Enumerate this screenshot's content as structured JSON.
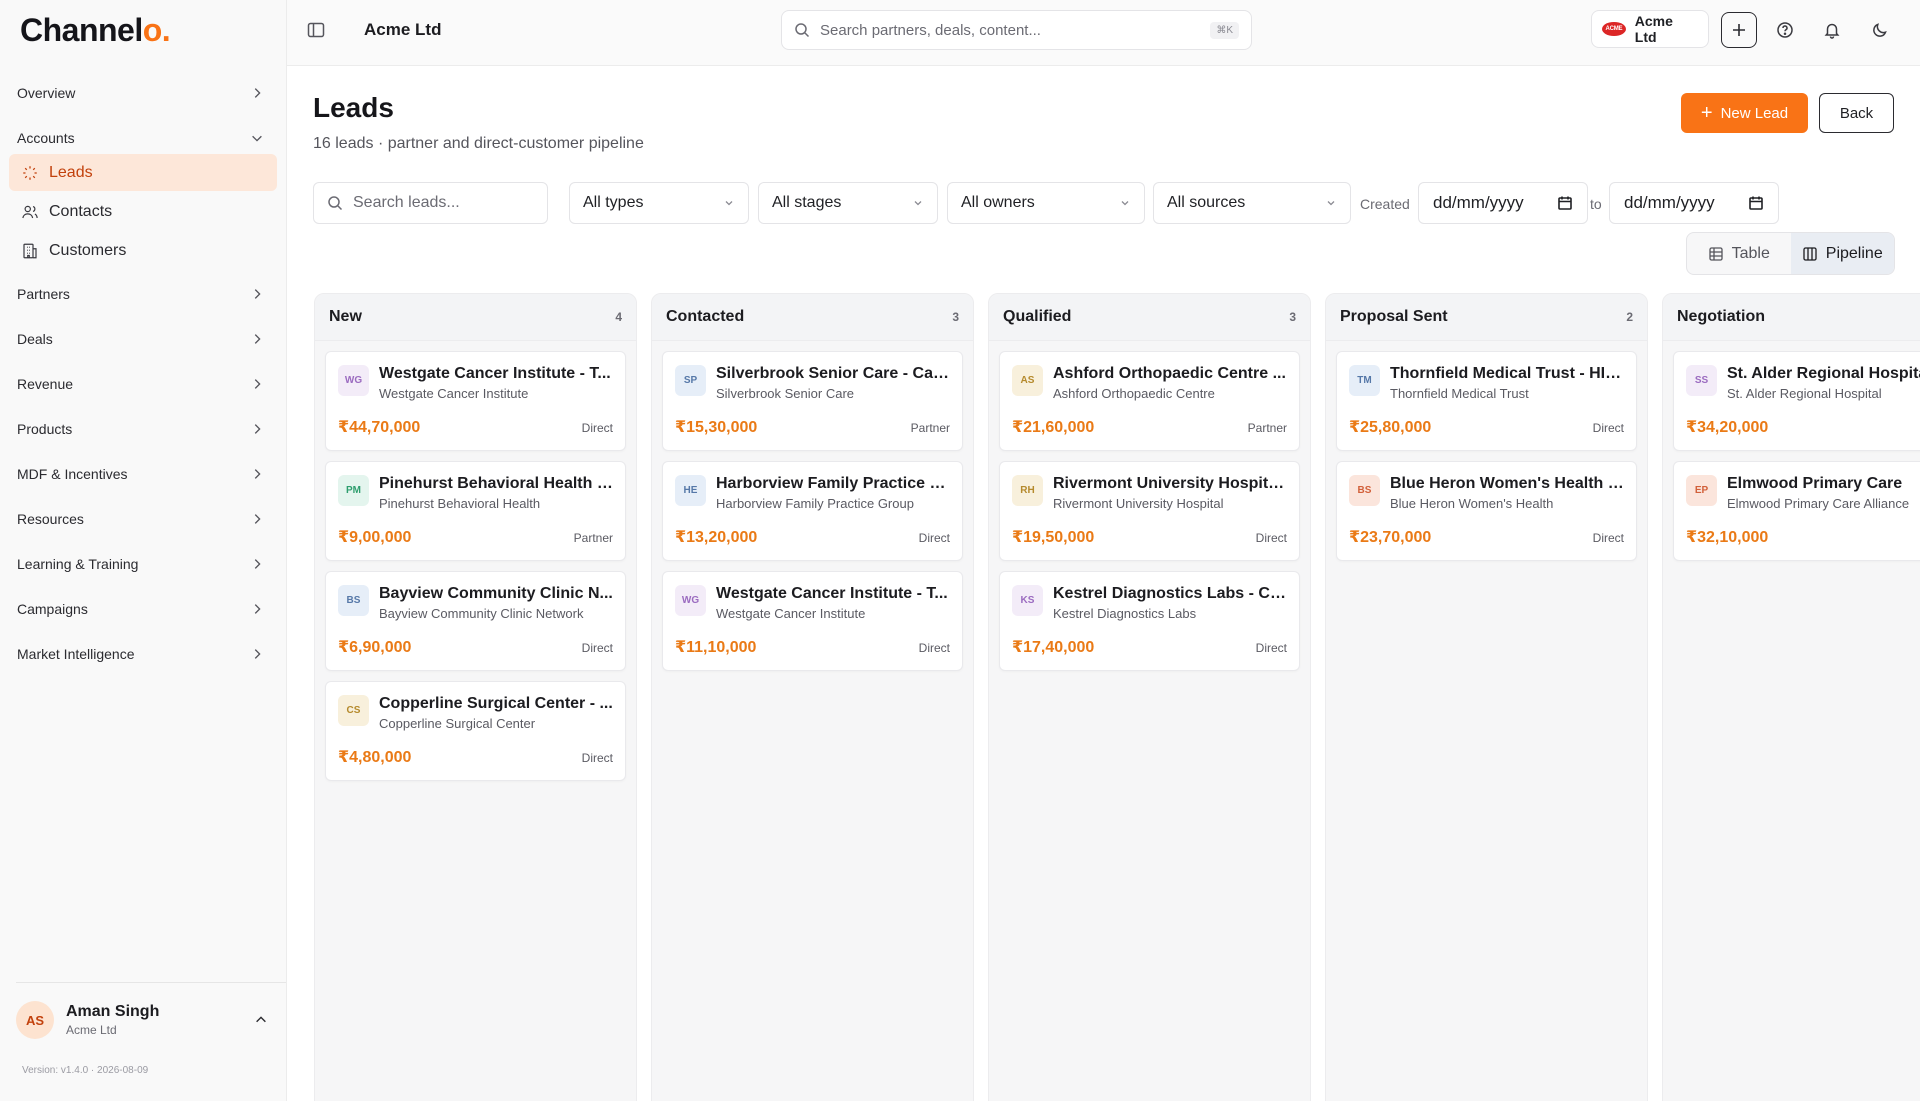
{
  "app": {
    "logo_main": "Channel",
    "logo_accent": "o."
  },
  "sidebar": {
    "top_items": [
      {
        "label": "Overview"
      },
      {
        "label": "Accounts"
      }
    ],
    "sub_items": [
      {
        "label": "Leads",
        "icon": "leads-icon",
        "active": true
      },
      {
        "label": "Contacts",
        "icon": "contacts-icon"
      },
      {
        "label": "Customers",
        "icon": "customers-icon"
      }
    ],
    "items": [
      {
        "label": "Partners"
      },
      {
        "label": "Deals"
      },
      {
        "label": "Revenue"
      },
      {
        "label": "Products"
      },
      {
        "label": "MDF & Incentives"
      },
      {
        "label": "Resources"
      },
      {
        "label": "Learning & Training"
      },
      {
        "label": "Campaigns"
      },
      {
        "label": "Market Intelligence"
      }
    ],
    "user": {
      "initials": "AS",
      "name": "Aman Singh",
      "org": "Acme Ltd"
    },
    "version": "Version: v1.4.0 · 2026-08-09"
  },
  "topbar": {
    "org_title": "Acme Ltd",
    "search_placeholder": "Search partners, deals, content...",
    "search_shortcut": "⌘K",
    "org_switch_label": "Acme Ltd",
    "org_logo_text": "ACME"
  },
  "page": {
    "title": "Leads",
    "subtitle": "16 leads · partner and direct-customer pipeline",
    "new_button": "New Lead",
    "back_button": "Back"
  },
  "filters": {
    "search_placeholder": "Search leads...",
    "type": "All types",
    "stage": "All stages",
    "owner": "All owners",
    "source": "All sources",
    "created_label": "Created",
    "to_label": "to",
    "date_from": "dd/mm/yyyy",
    "date_to": "dd/mm/yyyy"
  },
  "view_toggle": {
    "table": "Table",
    "pipeline": "Pipeline",
    "active": "pipeline"
  },
  "colors": {
    "accent": "#f97316",
    "amount": "#ea7a16"
  },
  "columns": [
    {
      "title": "New",
      "count": "4",
      "cards": [
        {
          "initials": "WG",
          "title": "Westgate Cancer Institute - T...",
          "org": "Westgate Cancer Institute",
          "amount": "₹44,70,000",
          "type": "Direct",
          "badge_bg": "#f3ecf8",
          "badge_fg": "#9b6bc0"
        },
        {
          "initials": "PM",
          "title": "Pinehurst Behavioral Health -...",
          "org": "Pinehurst Behavioral Health",
          "amount": "₹9,00,000",
          "type": "Partner",
          "badge_bg": "#e4f5ee",
          "badge_fg": "#2e9e6e"
        },
        {
          "initials": "BS",
          "title": "Bayview Community Clinic N...",
          "org": "Bayview Community Clinic Network",
          "amount": "₹6,90,000",
          "type": "Direct",
          "badge_bg": "#e6eef8",
          "badge_fg": "#5678a8"
        },
        {
          "initials": "CS",
          "title": "Copperline Surgical Center - ...",
          "org": "Copperline Surgical Center",
          "amount": "₹4,80,000",
          "type": "Direct",
          "badge_bg": "#f8f0dc",
          "badge_fg": "#b58a2c"
        }
      ]
    },
    {
      "title": "Contacted",
      "count": "3",
      "cards": [
        {
          "initials": "SP",
          "title": "Silverbrook Senior Care - Car...",
          "org": "Silverbrook Senior Care",
          "amount": "₹15,30,000",
          "type": "Partner",
          "badge_bg": "#e6eef8",
          "badge_fg": "#5678a8"
        },
        {
          "initials": "HE",
          "title": "Harborview Family Practice G...",
          "org": "Harborview Family Practice Group",
          "amount": "₹13,20,000",
          "type": "Direct",
          "badge_bg": "#e6eef8",
          "badge_fg": "#5678a8"
        },
        {
          "initials": "WG",
          "title": "Westgate Cancer Institute - T...",
          "org": "Westgate Cancer Institute",
          "amount": "₹11,10,000",
          "type": "Direct",
          "badge_bg": "#f3ecf8",
          "badge_fg": "#9b6bc0"
        }
      ]
    },
    {
      "title": "Qualified",
      "count": "3",
      "cards": [
        {
          "initials": "AS",
          "title": "Ashford Orthopaedic Centre ...",
          "org": "Ashford Orthopaedic Centre",
          "amount": "₹21,60,000",
          "type": "Partner",
          "badge_bg": "#f8f0dc",
          "badge_fg": "#b58a2c"
        },
        {
          "initials": "RH",
          "title": "Rivermont University Hospital...",
          "org": "Rivermont University Hospital",
          "amount": "₹19,50,000",
          "type": "Direct",
          "badge_bg": "#f8f0dc",
          "badge_fg": "#b58a2c"
        },
        {
          "initials": "KS",
          "title": "Kestrel Diagnostics Labs - Cli...",
          "org": "Kestrel Diagnostics Labs",
          "amount": "₹17,40,000",
          "type": "Direct",
          "badge_bg": "#f3ecf8",
          "badge_fg": "#9b6bc0"
        }
      ]
    },
    {
      "title": "Proposal Sent",
      "count": "2",
      "cards": [
        {
          "initials": "TM",
          "title": "Thornfield Medical Trust - HIP...",
          "org": "Thornfield Medical Trust",
          "amount": "₹25,80,000",
          "type": "Direct",
          "badge_bg": "#e6eef8",
          "badge_fg": "#5678a8"
        },
        {
          "initials": "BS",
          "title": "Blue Heron Women's Health -...",
          "org": "Blue Heron Women's Health",
          "amount": "₹23,70,000",
          "type": "Direct",
          "badge_bg": "#fbe5dc",
          "badge_fg": "#d2603a"
        }
      ]
    },
    {
      "title": "Negotiation",
      "count": "",
      "cards": [
        {
          "initials": "SS",
          "title": "St. Alder Regional Hospital",
          "org": "St. Alder Regional Hospital",
          "amount": "₹34,20,000",
          "type": "",
          "badge_bg": "#f3ecf8",
          "badge_fg": "#9b6bc0"
        },
        {
          "initials": "EP",
          "title": "Elmwood Primary Care",
          "org": "Elmwood Primary Care Alliance",
          "amount": "₹32,10,000",
          "type": "",
          "badge_bg": "#fbe5dc",
          "badge_fg": "#d2603a"
        }
      ]
    }
  ]
}
